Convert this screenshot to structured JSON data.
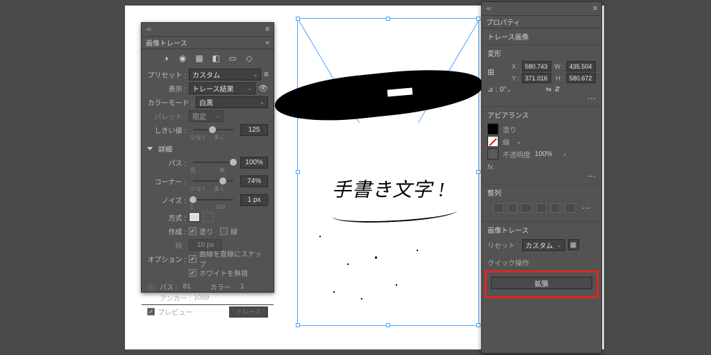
{
  "tracePanel": {
    "title": "画像トレース",
    "presetLabel": "プリセット :",
    "presetValue": "カスタム",
    "displayLabel": "表示 :",
    "displayValue": "トレース結果",
    "colorModeLabel": "カラーモード :",
    "colorModeValue": "白黒",
    "paletteLabel": "パレット :",
    "paletteValue": "限定",
    "thresholdLabel": "しきい値 :",
    "thresholdValue": "125",
    "threshMin": "少なく",
    "threshMax": "多く",
    "detailHeader": "詳細",
    "pathsLabel": "パス :",
    "pathsValue": "100%",
    "pathsMin": "低",
    "pathsMax": "高",
    "cornerLabel": "コーナー :",
    "cornerValue": "74%",
    "cornerMin": "少なく",
    "cornerMax": "多く",
    "noiseLabel": "ノイズ :",
    "noiseValue": "1 px",
    "noiseMin": "1",
    "noiseMax": "100",
    "methodLabel": "方式 :",
    "makeLabel": "作成 :",
    "makeFill": "塗り",
    "makeStroke": "線",
    "strokeLabel": "線 :",
    "strokeValue": "10 px",
    "optionsLabel": "オプション :",
    "snapCheck": "曲線を直線にスナップ",
    "ignoreWhiteCheck": "ホワイトを無視",
    "pathsInfoLabel": "パス :",
    "pathsInfoValue": "81",
    "colorsInfoLabel": "カラー :",
    "colorsInfoValue": "1",
    "anchorsLabel": "アンカー :",
    "anchorsValue": "1059",
    "previewCheck": "プレビュー",
    "traceButton": "トレース"
  },
  "propPanel": {
    "title": "プロパティ",
    "subtitle": "トレース画像",
    "transformHeader": "変形",
    "xLabel": "X :",
    "xValue": "580.743",
    "yLabel": "Y :",
    "yValue": "371.016",
    "wLabel": "W :",
    "wValue": "435.504",
    "hLabel": "H :",
    "hValue": "580.672",
    "angleLabel": "⊿ :",
    "angleValue": "0°",
    "appearanceHeader": "アピアランス",
    "fillLabel": "塗り",
    "strokeLabel": "線",
    "strokeWidth": "",
    "opacityLabel": "不透明度",
    "opacityValue": "100%",
    "fxLabel": "fx.",
    "alignHeader": "整列",
    "traceHeader": "画像トレース",
    "presetLabel": "リセット :",
    "presetValue": "カスタム",
    "quickActionsHeader": "クイック操作",
    "expandButton": "拡張"
  },
  "canvas": {
    "handText": "手書き文字 !"
  }
}
